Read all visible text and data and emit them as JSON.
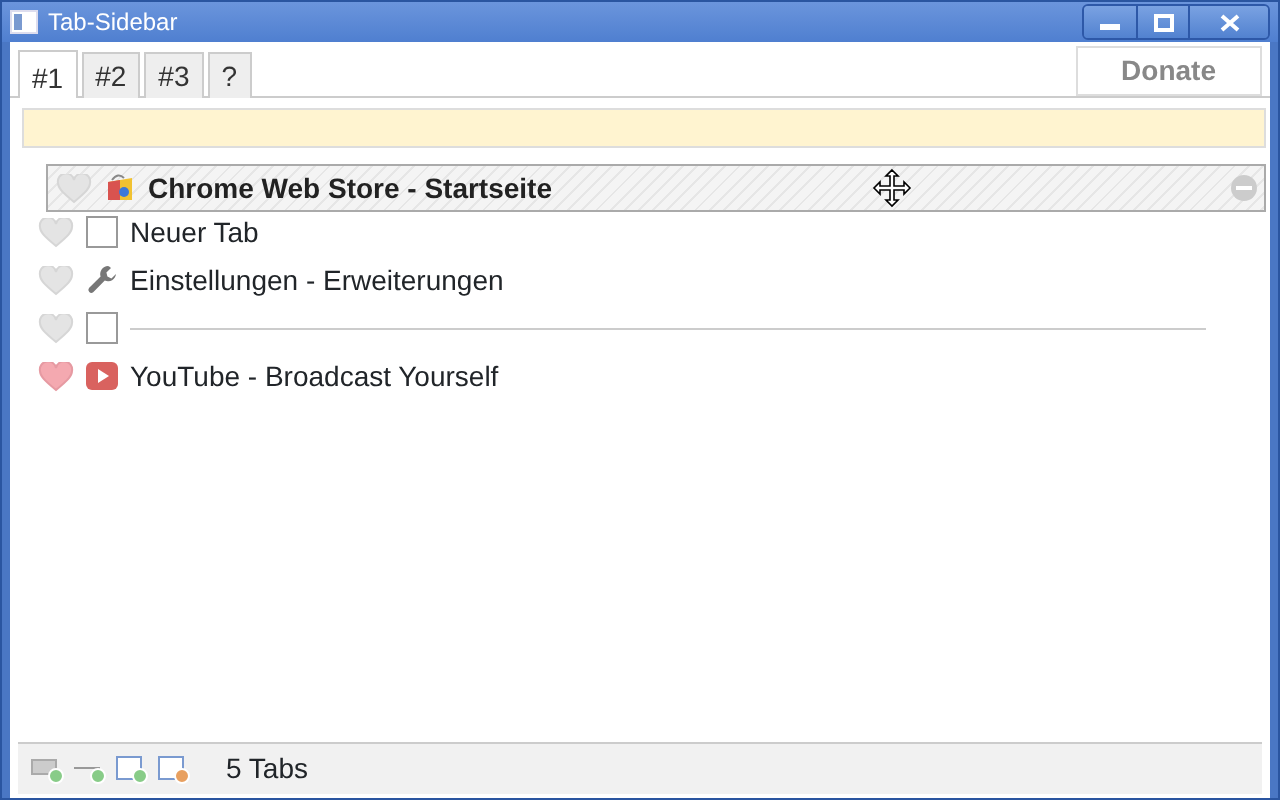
{
  "window": {
    "title": "Tab-Sidebar"
  },
  "tabs": [
    {
      "label": "#1",
      "selected": true
    },
    {
      "label": "#2",
      "selected": false
    },
    {
      "label": "#3",
      "selected": false
    },
    {
      "label": "?",
      "selected": false
    }
  ],
  "donate_button": "Donate",
  "dragged_tab": {
    "title": "Chrome Web Store - Startseite",
    "favorite": false
  },
  "tab_list": [
    {
      "kind": "blank",
      "title": "Neuer Tab",
      "favorite": false
    },
    {
      "kind": "settings",
      "title": "Einstellungen - Erweiterungen",
      "favorite": false
    },
    {
      "kind": "separator",
      "favorite": false
    },
    {
      "kind": "video",
      "title": "YouTube - Broadcast Yourself",
      "favorite": true
    }
  ],
  "status_bar": {
    "count": "5 Tabs"
  }
}
